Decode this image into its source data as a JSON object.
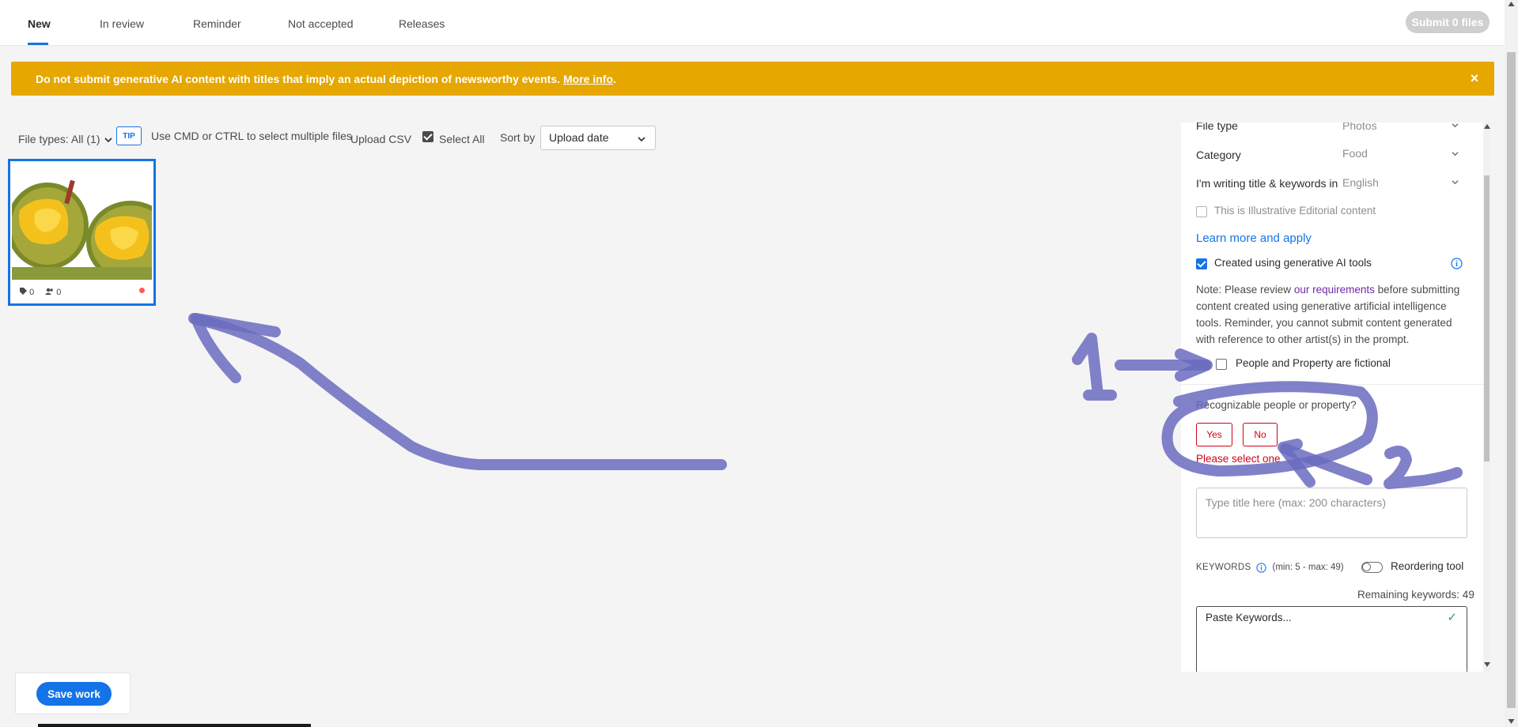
{
  "tabs": [
    {
      "label": "New",
      "active": true
    },
    {
      "label": "In review"
    },
    {
      "label": "Reminder"
    },
    {
      "label": "Not accepted"
    },
    {
      "label": "Releases"
    }
  ],
  "submit_label": "Submit 0 files",
  "banner": {
    "text": "Do not submit generative AI content with titles that imply an actual depiction of newsworthy events.",
    "link": "More info",
    "link_suffix": ".",
    "close_icon": "×"
  },
  "toolbar": {
    "file_types": "File types: All (1)",
    "tip": "TIP",
    "tip_text": "Use CMD or CTRL to select multiple files",
    "upload_csv": "Upload CSV",
    "select_all": "Select All",
    "sort_by": "Sort by",
    "sort_value": "Upload date"
  },
  "thumbnail": {
    "keywords_count": "0",
    "people_count": "0"
  },
  "panel": {
    "file_type_label": "File type",
    "file_type_value": "Photos",
    "category_label": "Category",
    "category_value": "Food",
    "language_label": "I'm writing title & keywords in",
    "language_value": "English",
    "illustrative_label": "This is Illustrative Editorial content",
    "learn_more": "Learn more and apply",
    "ai_label": "Created using generative AI tools",
    "note_prefix": "Note: Please review",
    "note_link": "our requirements",
    "note_suffix": "before submitting content created using generative artificial intelligence tools. Reminder, you cannot submit content generated with reference to other artist(s) in the prompt.",
    "fictional_label": "People and Property are fictional",
    "recognizable_question": "Recognizable people or property?",
    "yes": "Yes",
    "no": "No",
    "error": "Please select one",
    "title_placeholder": "Type title here (max: 200 characters)",
    "keywords_label": "KEYWORDS",
    "keywords_range": "(min: 5 - max: 49)",
    "reordering": "Reordering tool",
    "remaining": "Remaining keywords: 49",
    "paste_keywords": "Paste Keywords..."
  },
  "save_label": "Save work",
  "colors": {
    "accent": "#1473e6",
    "banner": "#e6a700",
    "error": "#d0021b",
    "annotation": "#6b6bc0"
  }
}
